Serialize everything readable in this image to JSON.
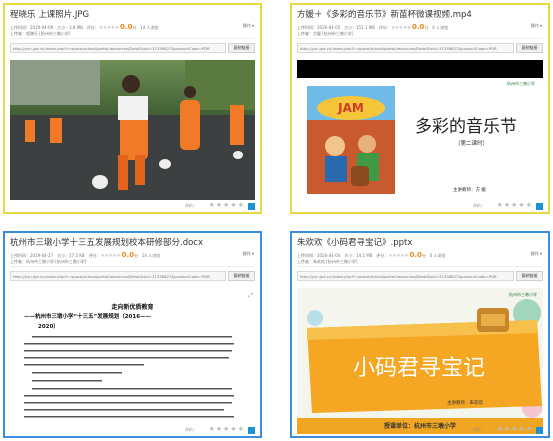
{
  "cards": [
    {
      "title": "程晓乐 上课照片.JPG",
      "upload_date": "上传时间：2020-04-09",
      "size": "大小：3.8 MB",
      "rating_label": "评分：",
      "score": "0.0",
      "score_suffix": "分",
      "views": "14 人浏览",
      "uploader": "上传者：程晓乐 [杭州市三墩小学]",
      "url": "http://yun.jpe.cn/index.php?r=space/school/portal/resources/Detail&sid=31338827&productCode=PDR",
      "copy_label": "复制链接",
      "menu": "操作"
    },
    {
      "title": "方媛＋《多彩的音乐节》新苗杯微课视频.mp4",
      "upload_date": "上传时间：2020-04-05",
      "size": "大小：151.1 MB",
      "rating_label": "评分：",
      "score": "0.0",
      "score_suffix": "分",
      "views": "0 人浏览",
      "uploader": "上传者：方媛 [杭州市三墩小学]",
      "url": "http://yun.jpe.cn/index.php?r=space/school/portal/resources/Detail&sid=31338827&productCode=PDR",
      "copy_label": "复制链接",
      "menu": "操作",
      "slide_title": "多彩的音乐节",
      "slide_sub": "（第二课时）",
      "slide_presenter": "主讲教师：方  媛",
      "slide_logo": "杭州市三墩小学",
      "book_title": "JAM"
    },
    {
      "title": "杭州市三墩小学十三五发展规划校本研修部分.docx",
      "upload_date": "上传时间：2019-04-27",
      "size": "大小：27.5 KB",
      "rating_label": "评分：",
      "score": "0.0",
      "score_suffix": "分",
      "views": "14 人浏览",
      "uploader": "上传者：杭州市三墩小学 [杭州市三墩小学]",
      "url": "http://yun.jpe.cn/index.php?r=space/school/portal/resources/Detail&sid=31338827&productCode=PDR",
      "copy_label": "复制链接",
      "menu": "操作",
      "doc_heading1": "走向新优质教育",
      "doc_heading2": "——杭州市三墩小学“十三五”发展规划（2016——",
      "doc_heading3": "2020）"
    },
    {
      "title": "朱欢欢《小码君寻宝记》.pptx",
      "upload_date": "上传时间：2020-04-04",
      "size": "大小：14.1 MB",
      "rating_label": "评分：",
      "score": "0.0",
      "score_suffix": "分",
      "views": "0 人浏览",
      "uploader": "上传者：朱欢欢 [杭州市三墩小学]",
      "url": "http://yun.jpe.cn/index.php?r=space/school/portal/resources/Detail&sid=31338827&productCode=PDR",
      "copy_label": "复制链接",
      "menu": "操作",
      "slide_title": "小码君寻宝记",
      "slide_presenter": "主讲教师：朱欢欢",
      "slide_school": "授课单位：杭州市三墩小学",
      "slide_logo": "杭州市三墩小学"
    }
  ],
  "footer_label": "评价："
}
